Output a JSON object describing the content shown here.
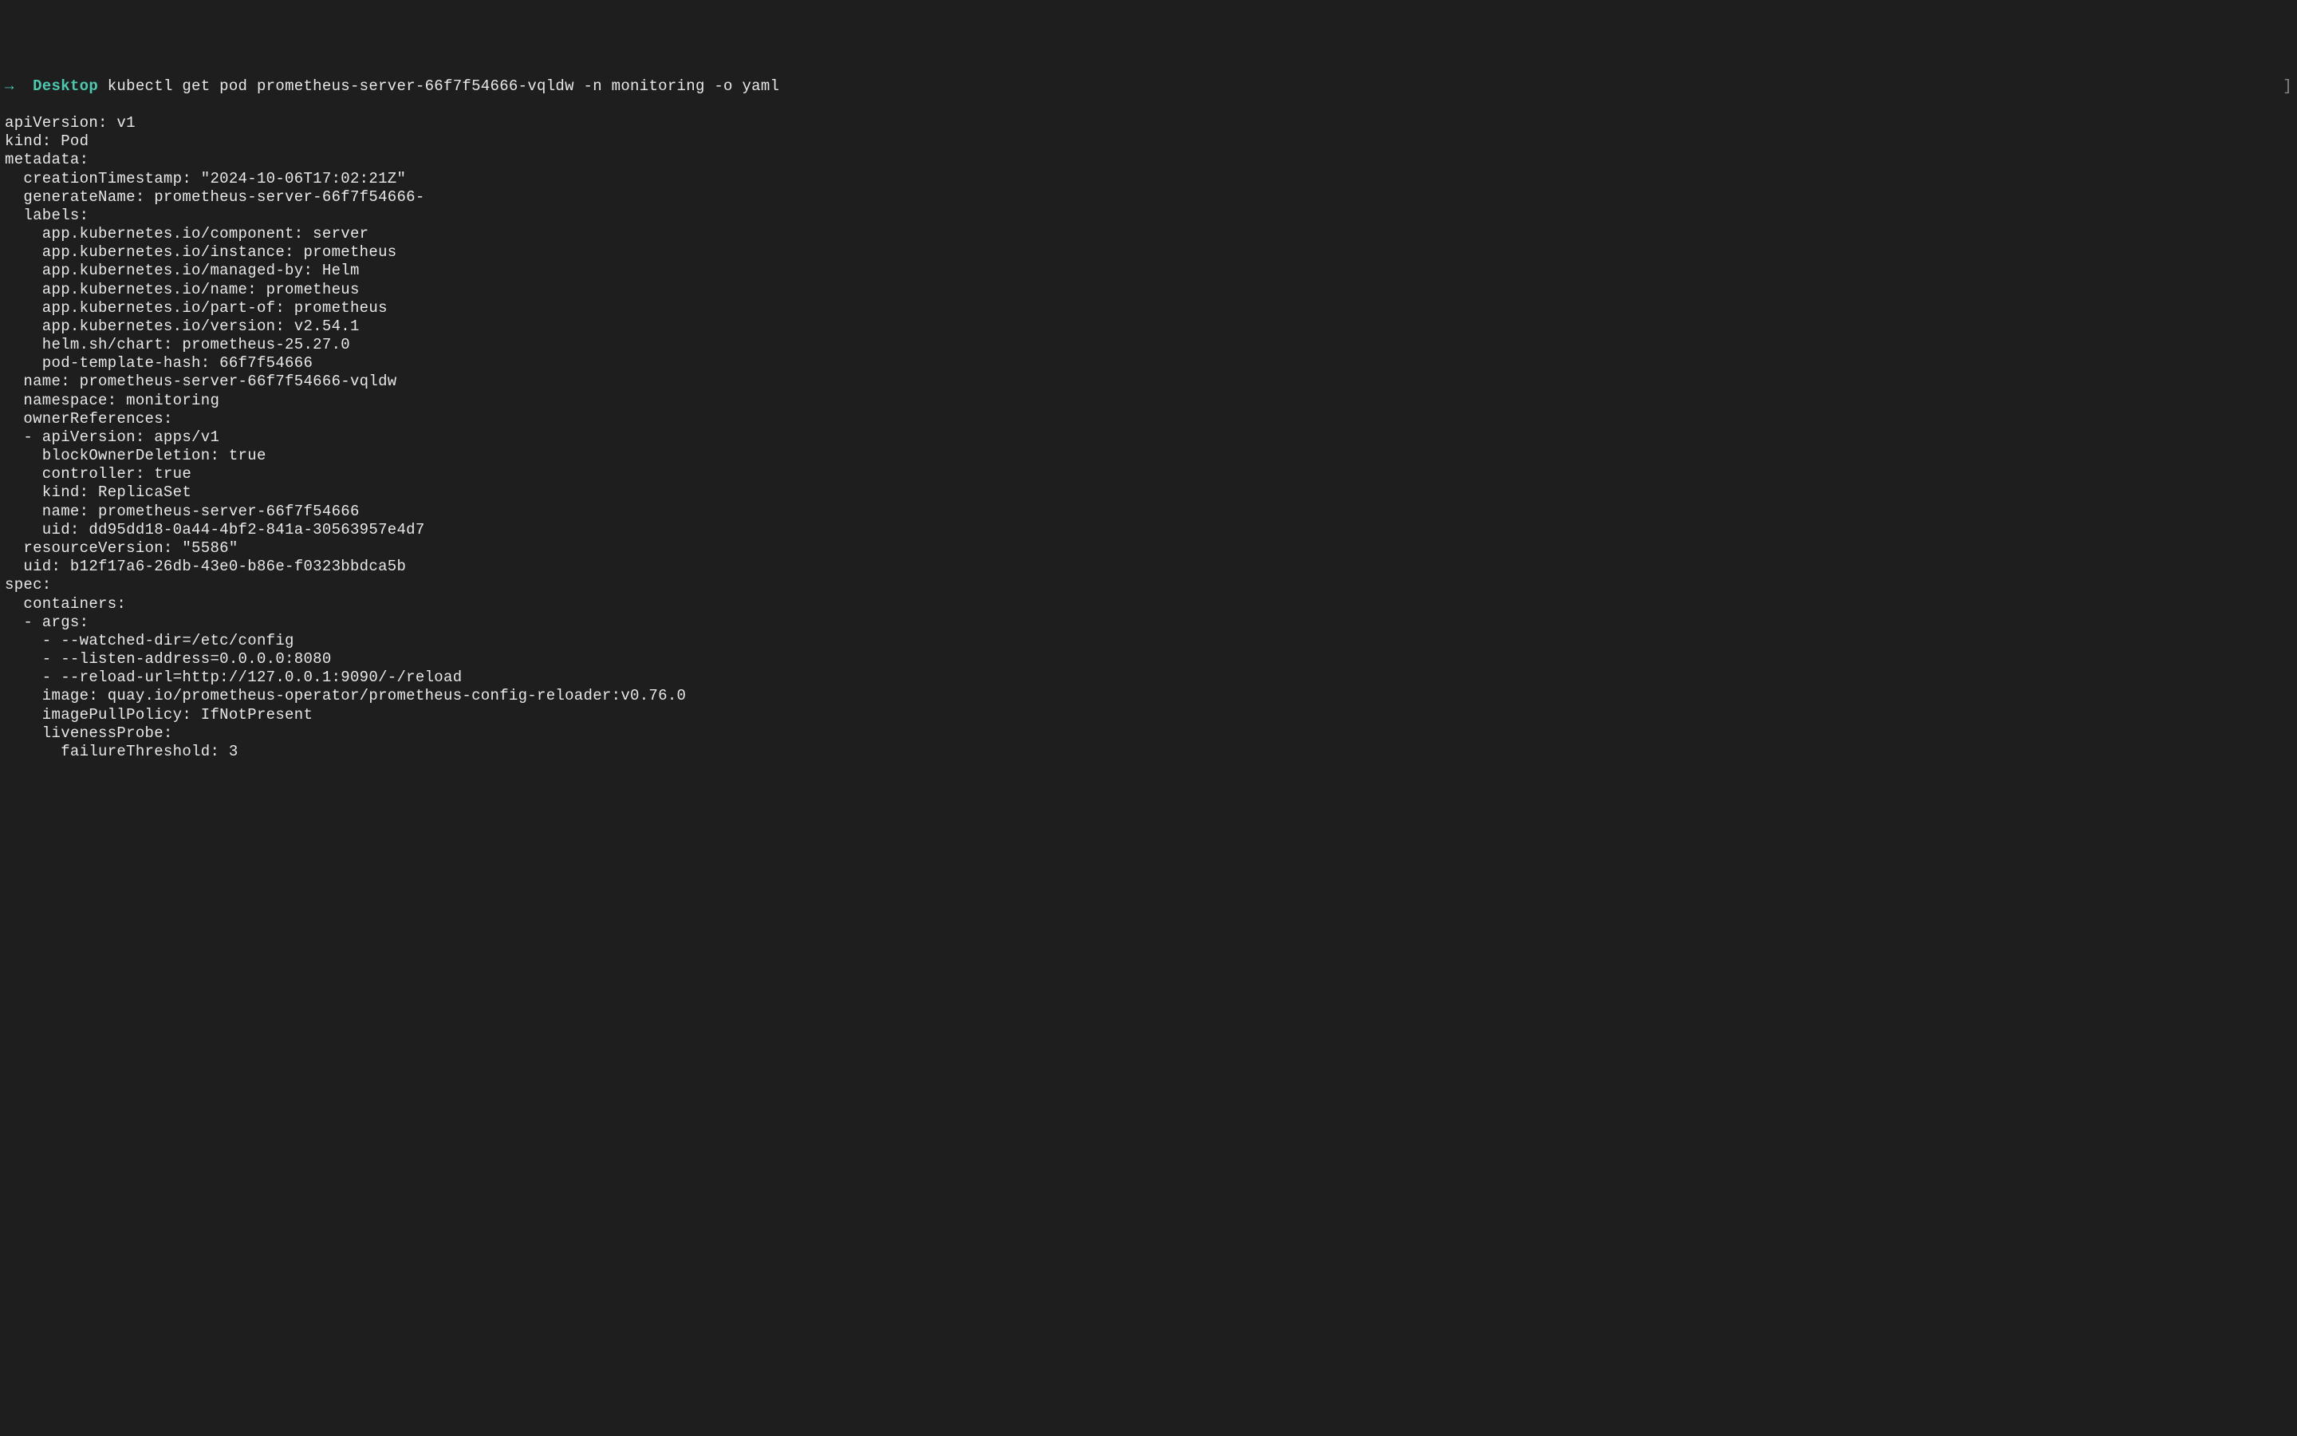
{
  "prompt": {
    "arrow": "→",
    "directory": "Desktop",
    "command": "kubectl get pod prometheus-server-66f7f54666-vqldw -n monitoring -o yaml"
  },
  "output": {
    "lines": [
      "apiVersion: v1",
      "kind: Pod",
      "metadata:",
      "  creationTimestamp: \"2024-10-06T17:02:21Z\"",
      "  generateName: prometheus-server-66f7f54666-",
      "  labels:",
      "    app.kubernetes.io/component: server",
      "    app.kubernetes.io/instance: prometheus",
      "    app.kubernetes.io/managed-by: Helm",
      "    app.kubernetes.io/name: prometheus",
      "    app.kubernetes.io/part-of: prometheus",
      "    app.kubernetes.io/version: v2.54.1",
      "    helm.sh/chart: prometheus-25.27.0",
      "    pod-template-hash: 66f7f54666",
      "  name: prometheus-server-66f7f54666-vqldw",
      "  namespace: monitoring",
      "  ownerReferences:",
      "  - apiVersion: apps/v1",
      "    blockOwnerDeletion: true",
      "    controller: true",
      "    kind: ReplicaSet",
      "    name: prometheus-server-66f7f54666",
      "    uid: dd95dd18-0a44-4bf2-841a-30563957e4d7",
      "  resourceVersion: \"5586\"",
      "  uid: b12f17a6-26db-43e0-b86e-f0323bbdca5b",
      "spec:",
      "  containers:",
      "  - args:",
      "    - --watched-dir=/etc/config",
      "    - --listen-address=0.0.0.0:8080",
      "    - --reload-url=http://127.0.0.1:9090/-/reload",
      "    image: quay.io/prometheus-operator/prometheus-config-reloader:v0.76.0",
      "    imagePullPolicy: IfNotPresent",
      "    livenessProbe:",
      "      failureThreshold: 3"
    ]
  },
  "bracket": "]"
}
